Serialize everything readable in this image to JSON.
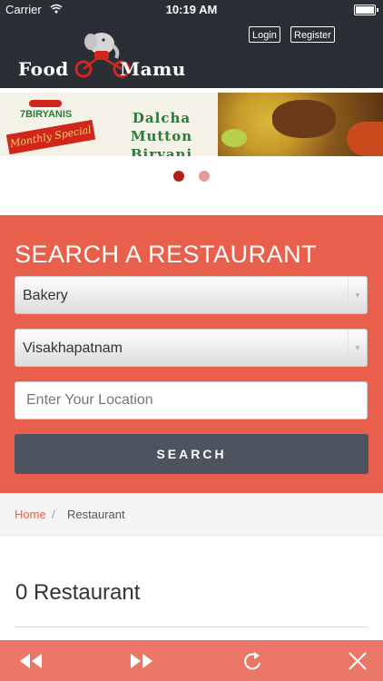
{
  "status_bar": {
    "carrier": "Carrier",
    "time": "10:19 AM"
  },
  "header": {
    "logo_word_1": "Food",
    "logo_word_2": "Mamu",
    "login_label": "Login",
    "register_label": "Register"
  },
  "banner": {
    "brand": "7BIRYANIS",
    "ribbon_text": "Monthly Special",
    "dish_line_1": "Dalcha",
    "dish_line_2": "Mutton Biryani",
    "slide_count": 2,
    "active_slide": 1
  },
  "search": {
    "title": "SEARCH A RESTAURANT",
    "category_value": "Bakery",
    "city_value": "Visakhapatnam",
    "location_placeholder": "Enter Your Location",
    "button_label": "SEARCH"
  },
  "breadcrumb": {
    "home": "Home",
    "separator": "/",
    "current": "Restaurant"
  },
  "results": {
    "count_label": "0 Restaurant"
  },
  "colors": {
    "header_bg": "#2b2f35",
    "accent": "#e8604c",
    "search_button": "#4e5360",
    "toolbar_bg": "#ea7668"
  },
  "toolbar_icons": [
    "rewind-icon",
    "fast-forward-icon",
    "refresh-icon",
    "close-icon"
  ]
}
